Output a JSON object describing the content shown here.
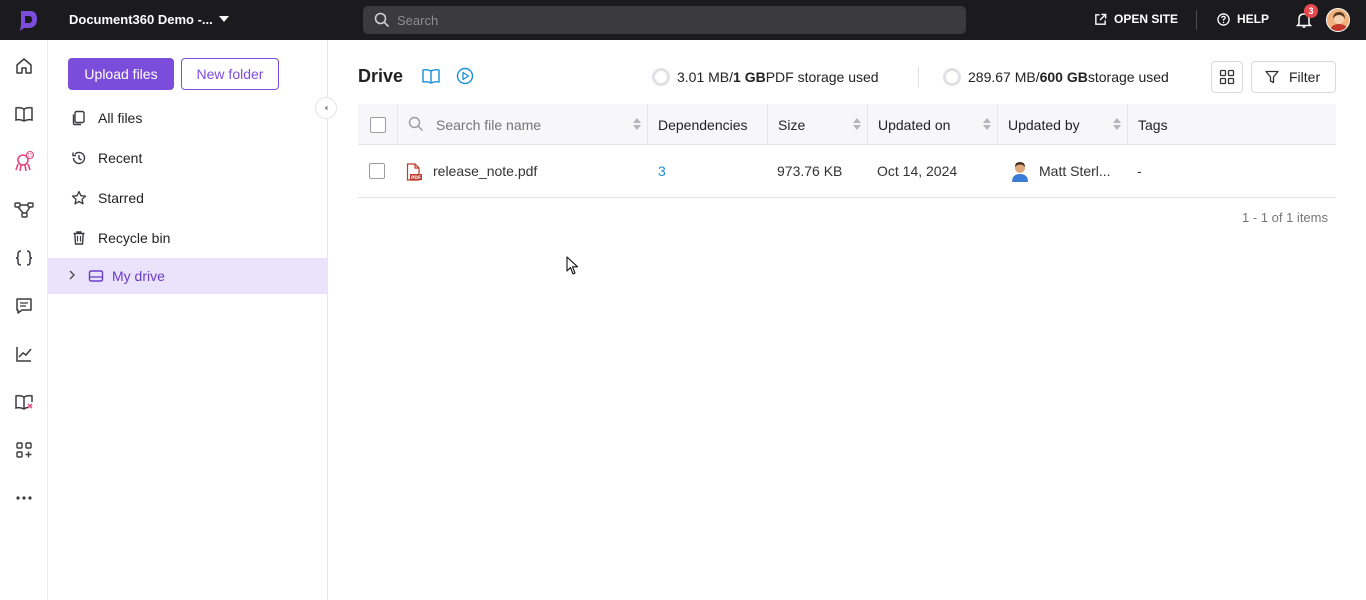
{
  "topbar": {
    "project_name": "Document360 Demo -...",
    "search_placeholder": "Search",
    "open_site_label": "OPEN SITE",
    "help_label": "HELP",
    "notification_count": "3"
  },
  "rail": {
    "icons": [
      "home-icon",
      "book-icon",
      "octopus-icon",
      "workflow-icon",
      "api-braces-icon",
      "feedback-icon",
      "analytics-icon",
      "book-x-icon",
      "apps-add-icon",
      "more-icon"
    ]
  },
  "sidebar": {
    "upload_label": "Upload files",
    "new_folder_label": "New folder",
    "items": [
      {
        "label": "All files",
        "icon": "files-icon"
      },
      {
        "label": "Recent",
        "icon": "history-icon"
      },
      {
        "label": "Starred",
        "icon": "star-icon"
      },
      {
        "label": "Recycle bin",
        "icon": "trash-icon"
      },
      {
        "label": "My drive",
        "icon": "drive-icon",
        "active": true
      }
    ]
  },
  "main": {
    "title": "Drive",
    "pdf_storage": {
      "used": "3.01 MB",
      "sep": " / ",
      "total": "1 GB",
      "suffix": " PDF storage used"
    },
    "storage": {
      "used": "289.67 MB",
      "sep": " / ",
      "total": "600 GB",
      "suffix": " storage used"
    },
    "filter_label": "Filter",
    "table": {
      "search_placeholder": "Search file name",
      "columns": [
        "Dependencies",
        "Size",
        "Updated on",
        "Updated by",
        "Tags"
      ],
      "rows": [
        {
          "name": "release_note.pdf",
          "dependencies": "3",
          "size": "973.76 KB",
          "updated_on": "Oct 14, 2024",
          "updated_by": "Matt Sterl...",
          "tags": "-"
        }
      ]
    },
    "pager_text": "1 - 1 of 1 items"
  },
  "colors": {
    "accent": "#7c4ddb",
    "topbar": "#1b1b1f",
    "active_bg": "#ebe3fb",
    "link": "#1a8fd6"
  }
}
